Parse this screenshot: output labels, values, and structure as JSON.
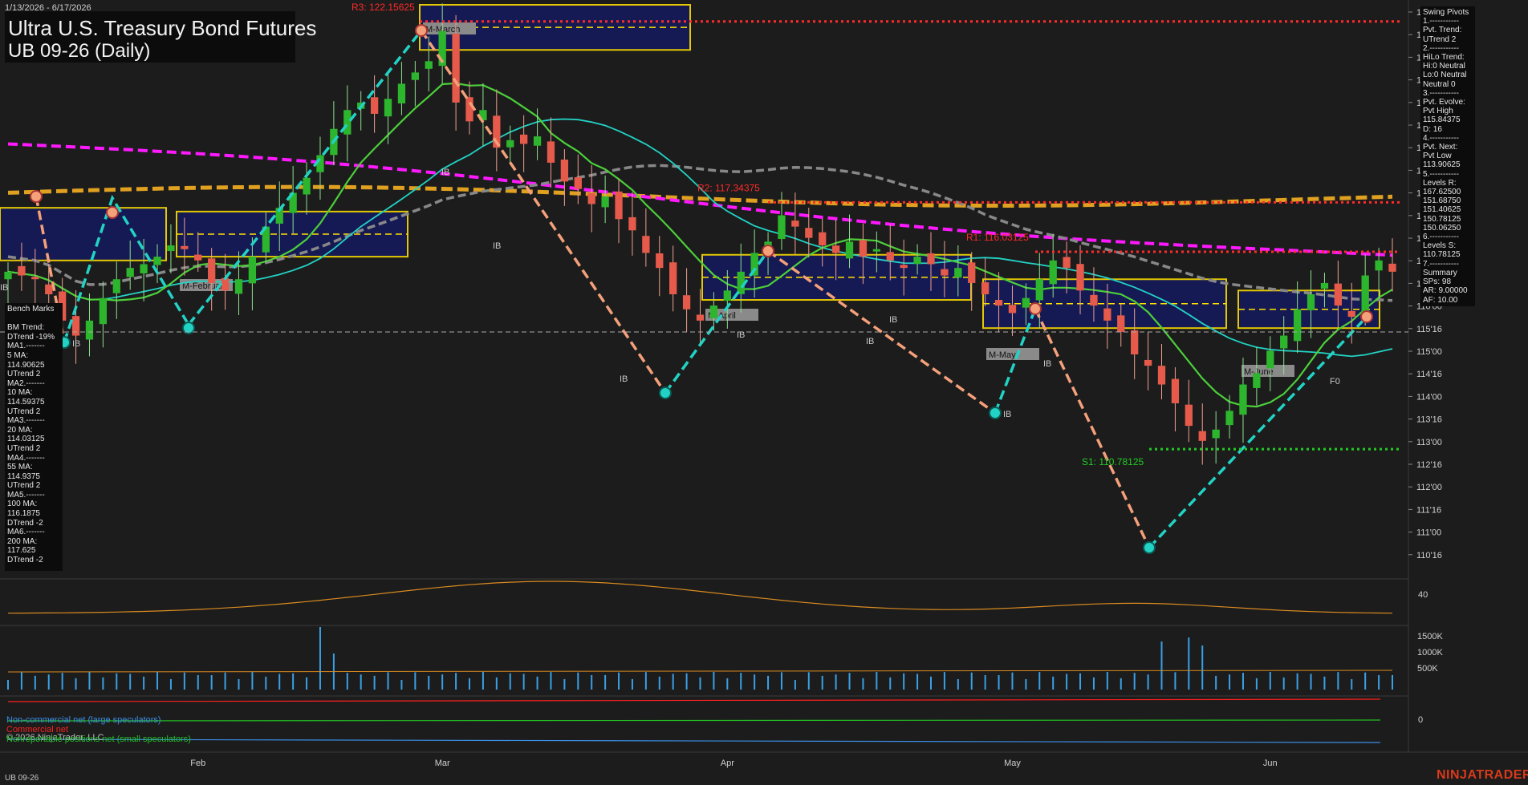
{
  "header": {
    "date_range": "1/13/2026 - 6/17/2026",
    "title_line1": "Ultra U.S. Treasury Bond Futures",
    "title_line2": "UB 09-26 (Daily)"
  },
  "right_panel": {
    "lines": [
      "Swing Pivots",
      "1.-----------",
      "Pvt. Trend:",
      "UTrend 2",
      "2.-----------",
      "HiLo Trend:",
      "Hi:0 Neutral",
      "Lo:0 Neutral",
      "Neutral 0",
      "3.-----------",
      "Pvt. Evolve:",
      "Pvt High",
      "115.84375",
      "D: 16",
      "4.-----------",
      "Pvt. Next:",
      "Pvt Low",
      "113.90625",
      "5.-----------",
      "Levels R:",
      "167.62500",
      "151.68750",
      "151.40625",
      "150.78125",
      "150.06250",
      "6.-----------",
      "Levels S:",
      "110.78125",
      "7.-----------",
      "Summary",
      "SPs: 98",
      "AR: 9.00000",
      "AF: 10.00"
    ]
  },
  "bench_panel": {
    "lines": [
      "Bench Marks",
      "",
      "BM Trend:",
      "DTrend -19%",
      "MA1.-------",
      "5 MA:",
      "114.90625",
      "UTrend 2",
      "MA2.-------",
      "10 MA:",
      "114.59375",
      "UTrend 2",
      "MA3.-------",
      "20 MA:",
      "114.03125",
      "UTrend 2",
      "MA4.-------",
      "55 MA:",
      "114.9375",
      "UTrend 2",
      "MA5.-------",
      "100 MA:",
      "116.1875",
      "DTrend -2",
      "MA6.-------",
      "200 MA:",
      "117.625",
      "DTrend -2"
    ]
  },
  "chart_data": {
    "type": "candlestick",
    "price_axis_labels": [
      "122'16",
      "122'00",
      "121'16",
      "121'00",
      "120'16",
      "120'00",
      "119'16",
      "119'00",
      "118'16",
      "118'00",
      "117'16",
      "117'00",
      "116'16",
      "116'00",
      "115'16",
      "115'00",
      "114'16",
      "114'00",
      "113'16",
      "113'00",
      "112'16",
      "112'00",
      "111'16",
      "111'00",
      "110'16"
    ],
    "price_range": [
      110.25,
      122.6
    ],
    "x_axis_labels": [
      "Feb",
      "Mar",
      "Apr",
      "May",
      "Jun"
    ],
    "x_axis_positions_day_index": [
      14,
      32,
      53,
      74,
      93
    ],
    "bars_count": 103,
    "closes": [
      115.5,
      115.4,
      115.3,
      114.9,
      114.2,
      113.8,
      114.2,
      114.8,
      115.3,
      115.6,
      115.7,
      115.9,
      116.2,
      116.1,
      115.8,
      115.2,
      115.0,
      115.3,
      115.9,
      116.7,
      117.2,
      117.6,
      118.0,
      118.6,
      119.3,
      119.8,
      120.0,
      119.7,
      120.1,
      120.5,
      120.8,
      121.1,
      121.9,
      120.0,
      119.5,
      119.8,
      118.8,
      119.0,
      118.9,
      119.1,
      118.4,
      117.9,
      117.7,
      117.3,
      117.5,
      116.9,
      116.6,
      116.0,
      115.6,
      114.9,
      114.5,
      114.2,
      114.6,
      115.0,
      115.5,
      116.0,
      116.3,
      117.0,
      116.7,
      116.4,
      116.2,
      116.0,
      116.3,
      115.9,
      116.1,
      115.8,
      115.6,
      115.9,
      115.7,
      115.4,
      115.6,
      115.2,
      114.9,
      114.6,
      114.4,
      114.8,
      115.3,
      115.8,
      115.6,
      115.0,
      114.6,
      114.2,
      113.9,
      113.3,
      113.0,
      112.5,
      112.0,
      111.4,
      111.0,
      111.3,
      111.8,
      112.5,
      112.8,
      113.4,
      113.8,
      114.5,
      114.9,
      115.2,
      114.6,
      114.3,
      115.4,
      115.8,
      115.5
    ],
    "ma_series": [
      {
        "name": "5 MA",
        "color": "#4ccf3a"
      },
      {
        "name": "20 MA",
        "color": "#22d3c5"
      },
      {
        "name": "55 MA",
        "color": "#888888"
      },
      {
        "name": "100 MA",
        "color": "#ff19ff"
      },
      {
        "name": "200 MA",
        "color": "#e0a020"
      }
    ],
    "levels": [
      {
        "label": "R3: 122.15625",
        "value": 122.15625,
        "color": "#ff2a2a"
      },
      {
        "label": "R2: 117.34375",
        "value": 117.34375,
        "color": "#ff2a2a"
      },
      {
        "label": "R1: 116.03125",
        "value": 116.03125,
        "color": "#ff2a2a"
      },
      {
        "label": "S1: 110.78125",
        "value": 110.78125,
        "color": "#22cc22"
      }
    ],
    "monthly_boxes": [
      {
        "label": "M-March"
      },
      {
        "label": "M-February"
      },
      {
        "label": "M-April"
      },
      {
        "label": "M-May"
      },
      {
        "label": "M-June"
      }
    ],
    "ib_labels": [
      "IB",
      "IB",
      "IB",
      "IB",
      "IB",
      "IB",
      "IB",
      "IB",
      "IB",
      "IB"
    ],
    "oscillator_axis_label": "40",
    "volume_axis_labels": [
      "1500K",
      "1000K",
      "500K"
    ],
    "cot_axis_label": "0",
    "cot_legend": [
      {
        "name": "Non-commercial net (large speculators)",
        "color": "#3a8ee6"
      },
      {
        "name": "Commercial net",
        "color": "#ff2020"
      },
      {
        "name": "Nonreportable positions net (small speculators)",
        "color": "#22c022"
      }
    ],
    "f0_label": "F0"
  },
  "footer": {
    "copyright": "© 2026 NinjaTrader, LLC",
    "symbol": "UB 09-26",
    "brand": "NINJATRADER"
  },
  "colors": {
    "background": "#1c1c1c",
    "box_fill": "#161a5c",
    "box_border": "#ffe000",
    "candle_up": "#2db52d",
    "candle_down": "#e55a4a"
  }
}
